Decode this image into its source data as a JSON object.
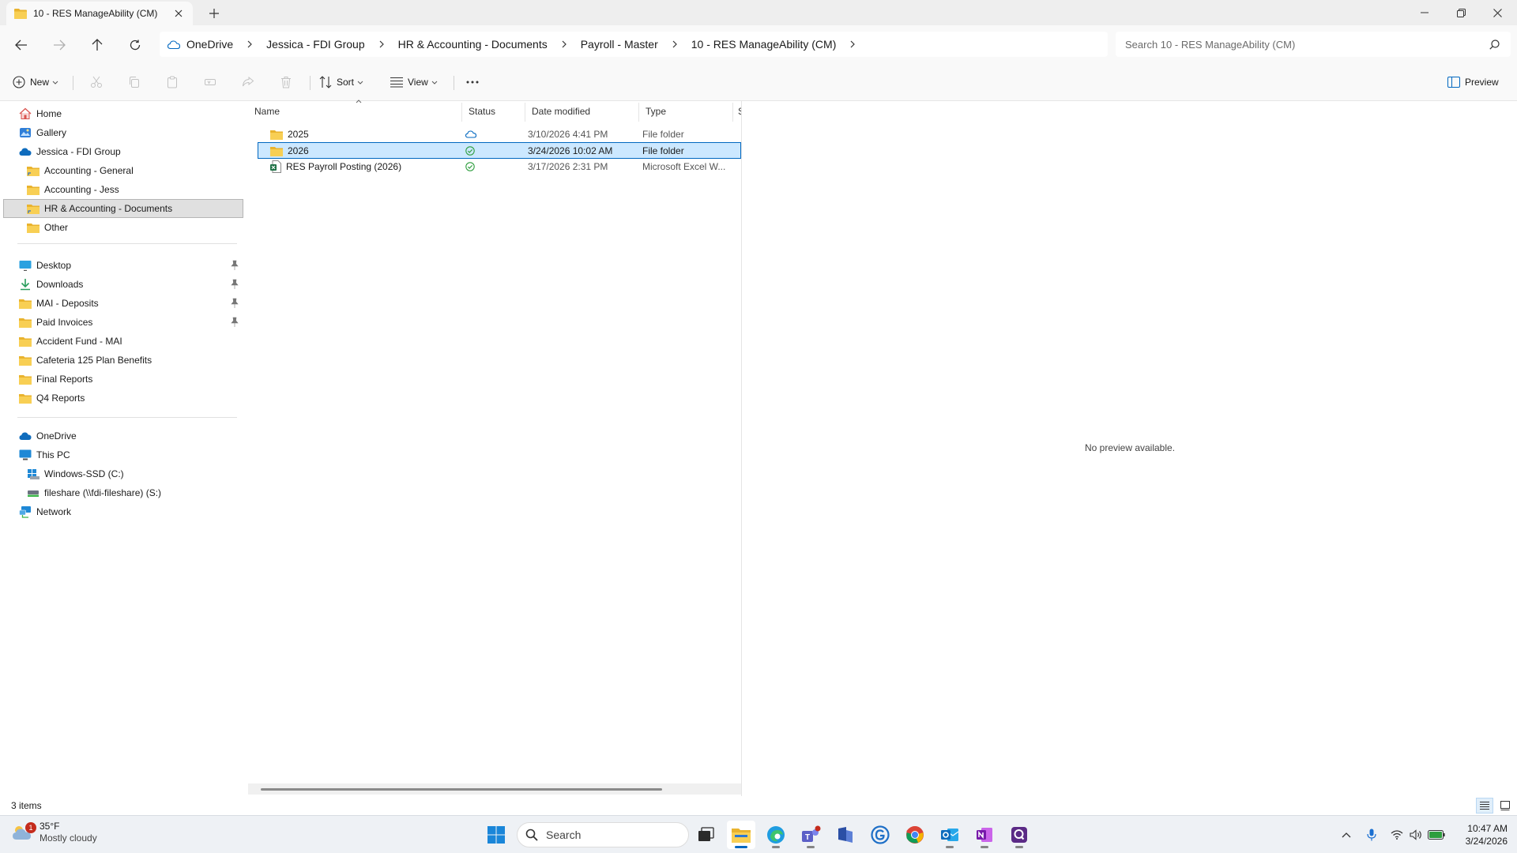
{
  "window": {
    "tab_title": "10 - RES ManageAbility (CM)",
    "new_tab_icon": "plus-icon",
    "controls": [
      "minimize-icon",
      "restore-icon",
      "close-icon"
    ]
  },
  "address": {
    "crumbs": [
      "OneDrive",
      "Jessica - FDI Group",
      "HR & Accounting - Documents",
      "Payroll - Master",
      "10 - RES ManageAbility (CM)"
    ],
    "search_placeholder": "Search 10 - RES ManageAbility (CM)"
  },
  "commands": {
    "new_label": "New",
    "sort_label": "Sort",
    "view_label": "View",
    "preview_label": "Preview",
    "disabled_icons": [
      "cut-icon",
      "copy-icon",
      "paste-icon",
      "rename-icon",
      "share-icon",
      "delete-icon"
    ]
  },
  "nav": {
    "top": [
      {
        "label": "Home",
        "icon": "home-icon"
      },
      {
        "label": "Gallery",
        "icon": "gallery-icon"
      },
      {
        "label": "Jessica - FDI Group",
        "icon": "onedrive-cloud-icon"
      },
      {
        "label": "Accounting - General",
        "icon": "shared-folder-icon"
      },
      {
        "label": "Accounting - Jess",
        "icon": "folder-icon"
      },
      {
        "label": "HR & Accounting - Documents",
        "icon": "shared-folder-icon",
        "selected": true
      },
      {
        "label": "Other",
        "icon": "folder-icon"
      }
    ],
    "quick": [
      {
        "label": "Desktop",
        "icon": "desktop-icon",
        "pinned": true
      },
      {
        "label": "Downloads",
        "icon": "download-icon",
        "pinned": true
      },
      {
        "label": "MAI - Deposits",
        "icon": "folder-icon",
        "pinned": true
      },
      {
        "label": "Paid Invoices",
        "icon": "folder-icon",
        "pinned": true
      },
      {
        "label": "Accident Fund - MAI",
        "icon": "folder-icon"
      },
      {
        "label": "Cafeteria 125 Plan Benefits",
        "icon": "folder-icon"
      },
      {
        "label": "Final Reports",
        "icon": "folder-icon"
      },
      {
        "label": "Q4 Reports",
        "icon": "folder-icon"
      }
    ],
    "devices": [
      {
        "label": "OneDrive",
        "icon": "onedrive-cloud-icon"
      },
      {
        "label": "This PC",
        "icon": "pc-icon"
      },
      {
        "label": "Windows-SSD (C:)",
        "icon": "drive-icon"
      },
      {
        "label": "fileshare (\\\\fdi-fileshare) (S:)",
        "icon": "network-drive-icon"
      },
      {
        "label": "Network",
        "icon": "network-icon"
      }
    ]
  },
  "list": {
    "columns": {
      "name": "Name",
      "status": "Status",
      "date": "Date modified",
      "type": "Type",
      "size": "S"
    },
    "rows": [
      {
        "name": "2025",
        "status": "cloud-icon",
        "date": "3/10/2026 4:41 PM",
        "type": "File folder",
        "icon": "folder-icon"
      },
      {
        "name": "2026",
        "status": "synced-check-icon",
        "date": "3/24/2026 10:02 AM",
        "type": "File folder",
        "icon": "folder-icon",
        "selected": true
      },
      {
        "name": "RES Payroll Posting (2026)",
        "status": "synced-check-icon",
        "date": "3/17/2026 2:31 PM",
        "type": "Microsoft Excel W...",
        "icon": "excel-file-icon"
      }
    ]
  },
  "preview": {
    "message": "No preview available."
  },
  "status": {
    "item_count": "3 items"
  },
  "taskbar": {
    "weather_temp": "35°F",
    "weather_cond": "Mostly cloudy",
    "weather_badge": "1",
    "search_label": "Search",
    "time": "10:47 AM",
    "date": "3/24/2026"
  },
  "colors": {
    "accent": "#0067c0",
    "selection": "#cce8ff",
    "folder": "#f4c542",
    "synced": "#2e9e3e"
  }
}
